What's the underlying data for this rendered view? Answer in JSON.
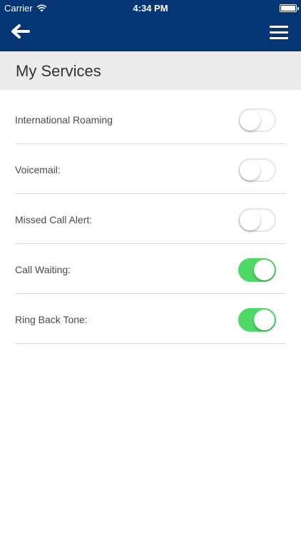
{
  "status_bar": {
    "carrier": "Carrier",
    "time": "4:34 PM",
    "icons": [
      "wifi-icon",
      "battery-icon"
    ]
  },
  "nav": {
    "back_icon": "arrow-left-icon",
    "menu_icon": "hamburger-menu-icon"
  },
  "colors": {
    "header_bg": "#053574",
    "section_bg": "#ececec",
    "toggle_on": "#4cd964"
  },
  "page": {
    "title": "My Services"
  },
  "services": [
    {
      "label": "International Roaming",
      "on": false
    },
    {
      "label": "Voicemail:",
      "on": false
    },
    {
      "label": "Missed Call Alert:",
      "on": false
    },
    {
      "label": "Call Waiting:",
      "on": true
    },
    {
      "label": "Ring Back Tone:",
      "on": true
    }
  ]
}
